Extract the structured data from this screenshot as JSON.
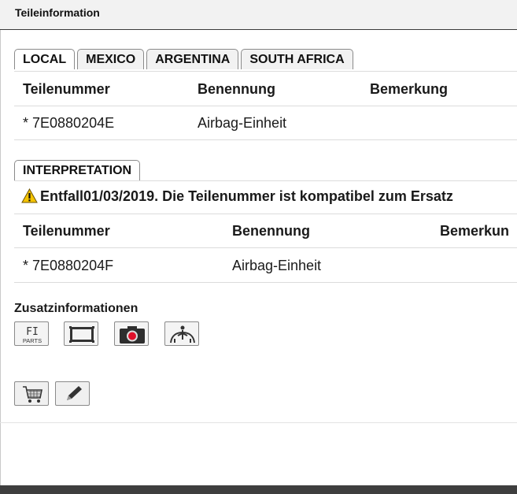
{
  "header": {
    "title": "Teileinformation"
  },
  "local_tabs": [
    {
      "label": "LOCAL",
      "active": true
    },
    {
      "label": "MEXICO",
      "active": false
    },
    {
      "label": "ARGENTINA",
      "active": false
    },
    {
      "label": "SOUTH AFRICA",
      "active": false
    }
  ],
  "local_table": {
    "columns": [
      "Teilenummer",
      "Benennung",
      "Bemerkung"
    ],
    "rows": [
      {
        "part_number": "* 7E0880204E",
        "name": "Airbag-Einheit",
        "remark": ""
      }
    ]
  },
  "interpretation": {
    "tab_label": "INTERPRETATION",
    "warning_text": "Entfall01/03/2019. Die Teilenummer ist kompatibel zum Ersatz",
    "columns": [
      "Teilenummer",
      "Benennung",
      "Bemerkun"
    ],
    "rows": [
      {
        "part_number": "* 7E0880204F",
        "name": "Airbag-Einheit",
        "remark": ""
      }
    ]
  },
  "additional_info": {
    "title": "Zusatzinformationen",
    "icons": [
      {
        "name": "fi-parts-icon",
        "line1": "FI",
        "line2": "PARTS"
      },
      {
        "name": "frame-icon"
      },
      {
        "name": "camera-icon"
      },
      {
        "name": "vehicle-seat-icon"
      }
    ]
  },
  "actions": [
    {
      "name": "cart-icon"
    },
    {
      "name": "pencil-icon"
    }
  ],
  "colors": {
    "warning_yellow": "#f5c400",
    "camera_red": "#e0102a",
    "bottom_bar": "#3e3e3e"
  }
}
